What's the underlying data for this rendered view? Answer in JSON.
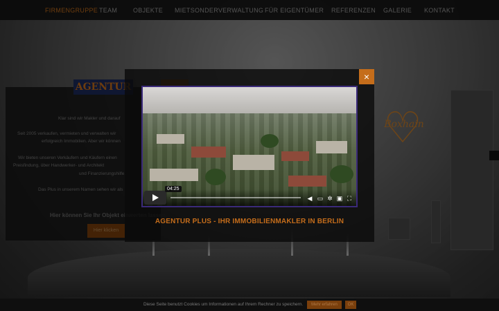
{
  "nav": {
    "items": [
      {
        "label": "FIRMENGRUPPE",
        "active": true
      },
      {
        "label": "TEAM",
        "active": false
      },
      {
        "label": "OBJEKTE",
        "active": false
      },
      {
        "label": "MIETSONDERVERWALTUNG",
        "active": false
      },
      {
        "label": "FÜR EIGENTÜMER",
        "active": false
      },
      {
        "label": "REFERENZEN",
        "active": false
      },
      {
        "label": "GALERIE",
        "active": false
      },
      {
        "label": "KONTAKT",
        "active": false
      }
    ]
  },
  "brand": {
    "logo_text": "AGENTUR",
    "heart_text": "Boxhain"
  },
  "panel": {
    "line1": "Klar sind wir Makler und darauf",
    "line2": "Seit 2005 verkaufen, vermieten und verwalten wir",
    "line3": "erfolgreich Immobilien. Aber wir können",
    "line4": "Wir bieten unseren Verkäufern und Käufern einen",
    "line5": "Preisfindung, über Handwerker- und Architekt",
    "line6": "und Finanzierungshilfe.",
    "line7": "Das Plus in unserem Namen sehen wir als",
    "cta": "Hier können Sie Ihr Objekt einwerten lassen.",
    "button": "Hier klicken"
  },
  "modal": {
    "close_label": "×",
    "video_time": "04:25",
    "video_title": "AGENTUR PLUS - IHR IMMOBILIENMAKLER IN BERLIN"
  },
  "cookie": {
    "text": "Diese Seite benutzt Cookies um Informationen auf Ihrem Rechner zu speichern.",
    "more": "Mehr erfahren",
    "ok": "OK"
  },
  "colors": {
    "accent": "#c56d1b",
    "nav_bg": "#141414"
  }
}
